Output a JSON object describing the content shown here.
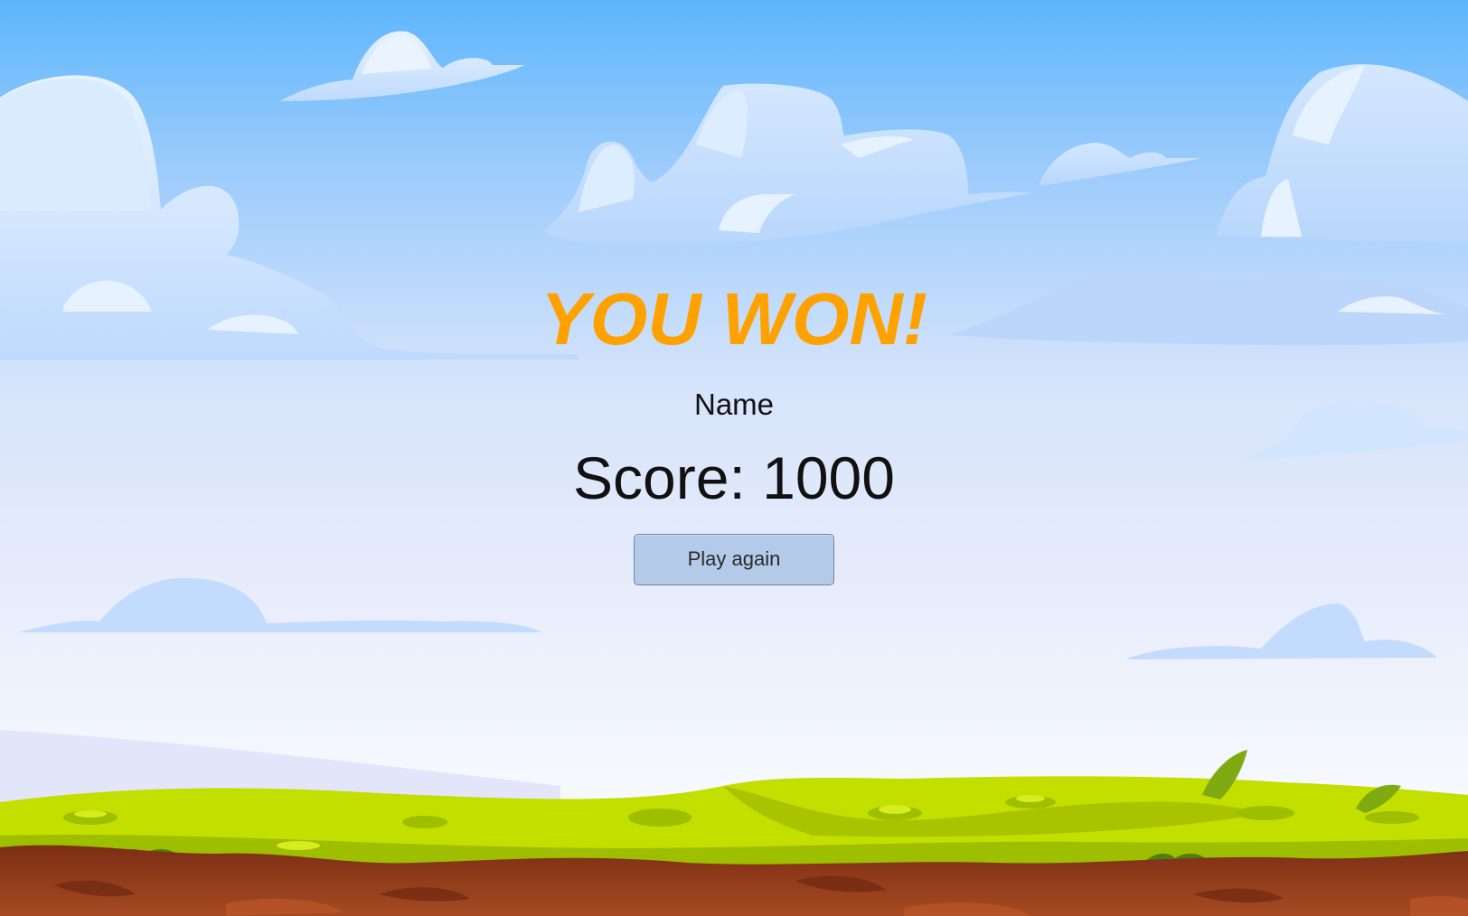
{
  "screen": {
    "title": "YOU WON!",
    "player_name": "Name",
    "score_label": "Score:",
    "score_value": "1000",
    "play_again_label": "Play again"
  },
  "colors": {
    "title": "#FFA200",
    "text": "#111111",
    "button_bg": "#B3CAE8",
    "button_border": "#6F86A8",
    "sky_top": "#5DB6FD",
    "sky_bottom": "#F4F8FE",
    "grass_light": "#C3DF00",
    "grass_dark": "#9EBE00",
    "dirt": "#8A3A1A"
  },
  "scene": {
    "background": "sky-with-clouds",
    "ground": "grass-and-dirt-strip"
  }
}
